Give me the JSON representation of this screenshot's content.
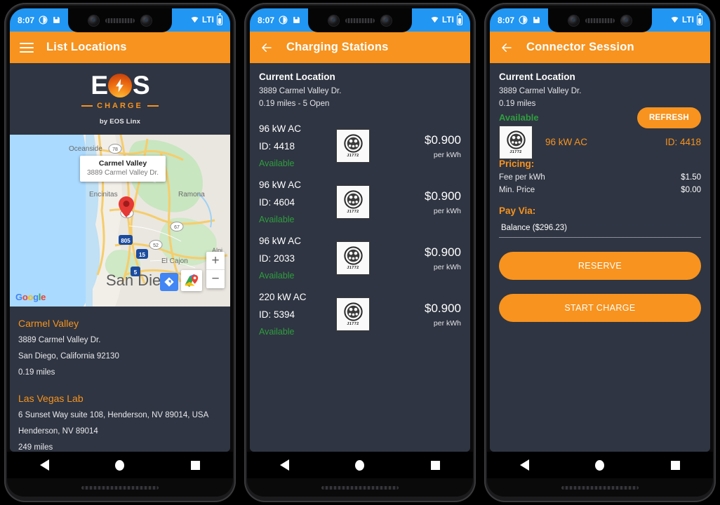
{
  "status_bar": {
    "time": "8:07",
    "network": "LTI",
    "wifi_icon": "wifi-icon",
    "battery_icon": "battery-icon"
  },
  "panel1": {
    "app_bar": {
      "menu_icon": "hamburger-menu-icon",
      "title": "List Locations"
    },
    "logo": {
      "text_left": "E",
      "text_right": "S",
      "word": "CHARGE",
      "byline": "by EOS Linx",
      "bolt_icon": "lightning-bolt-icon"
    },
    "map": {
      "info_window": {
        "title": "Carmel Valley",
        "subtitle": "3889 Carmel Valley Dr."
      },
      "pin_icon": "map-pin-icon",
      "watermark": "Google",
      "labels": [
        "Oceanside",
        "Encinitas",
        "Ramona",
        "El Cajon",
        "San Diego",
        "Alpi"
      ],
      "route_shields": [
        "78",
        "56",
        "67",
        "52",
        "805",
        "15",
        "5"
      ],
      "zoom_in": "+",
      "zoom_out": "−",
      "directions_icon": "directions-icon",
      "open_maps_icon": "google-maps-icon"
    },
    "locations": [
      {
        "name": "Carmel Valley",
        "address": "3889 Carmel Valley Dr.",
        "city": "San Diego, California 92130",
        "distance": "0.19 miles"
      },
      {
        "name": "Las Vegas Lab",
        "address": "6 Sunset Way suite 108, Henderson, NV 89014, USA",
        "city": "Henderson, NV 89014",
        "distance": "249 miles"
      }
    ]
  },
  "panel2": {
    "app_bar": {
      "back_icon": "back-arrow-icon",
      "title": "Charging Stations"
    },
    "current_location": {
      "heading": "Current Location",
      "address": "3889 Carmel Valley Dr.",
      "detail": "0.19 miles - 5 Open"
    },
    "stations": [
      {
        "power": "96 kW AC",
        "id": "ID: 4418",
        "status": "Available",
        "price": "$0.900",
        "unit": "per kWh",
        "connector": "J1772"
      },
      {
        "power": "96 kW AC",
        "id": "ID: 4604",
        "status": "Available",
        "price": "$0.900",
        "unit": "per kWh",
        "connector": "J1772"
      },
      {
        "power": "96 kW AC",
        "id": "ID: 2033",
        "status": "Available",
        "price": "$0.900",
        "unit": "per kWh",
        "connector": "J1772"
      },
      {
        "power": "220 kW AC",
        "id": "ID: 5394",
        "status": "Available",
        "price": "$0.900",
        "unit": "per kWh",
        "connector": "J1772"
      }
    ]
  },
  "panel3": {
    "app_bar": {
      "back_icon": "back-arrow-icon",
      "title": "Connector Session"
    },
    "current_location": {
      "heading": "Current Location",
      "address": "3889 Carmel Valley Dr.",
      "distance": "0.19 miles",
      "status": "Available"
    },
    "refresh_label": "REFRESH",
    "connector": {
      "label": "J1772",
      "power": "96 kW AC",
      "id": "ID: 4418"
    },
    "pricing": {
      "heading": "Pricing:",
      "rows": [
        {
          "key": "Fee per kWh",
          "value": "$1.50"
        },
        {
          "key": "Min. Price",
          "value": "$0.00"
        }
      ]
    },
    "pay_via": {
      "heading": "Pay Via:",
      "selected": "Balance ($296.23)"
    },
    "reserve_label": "RESERVE",
    "start_charge_label": "START CHARGE"
  },
  "nav_bar": {
    "back": "nav-back-icon",
    "home": "nav-home-icon",
    "recents": "nav-recents-icon"
  },
  "colors": {
    "accent": "#F7931E",
    "status_bar": "#2196F3",
    "background": "#2f3542",
    "available": "#2E9E3E"
  }
}
